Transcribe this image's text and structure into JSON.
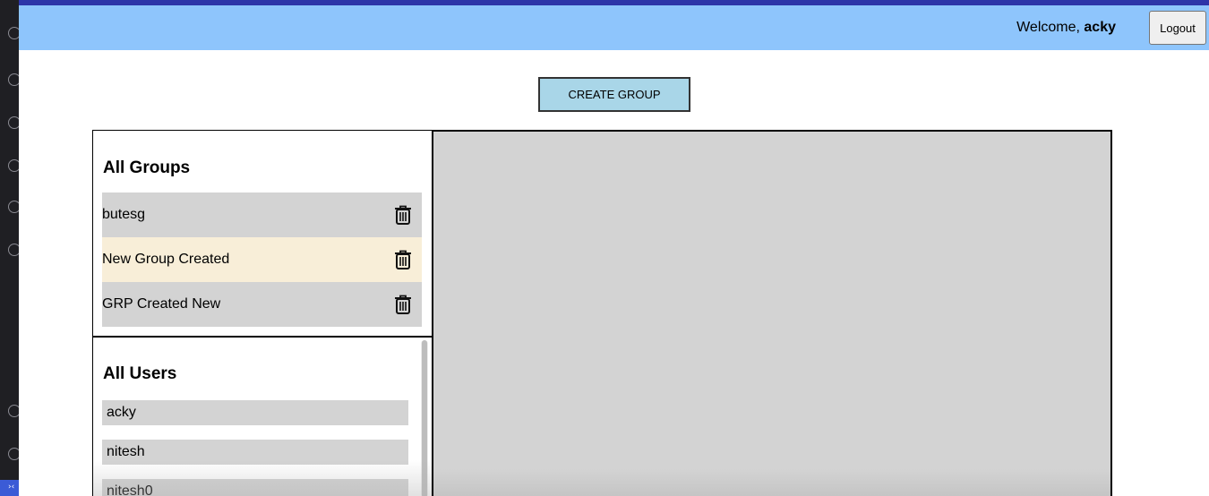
{
  "header": {
    "welcome_prefix": "Welcome,",
    "username": "acky",
    "logout_label": "Logout",
    "background": "#8ec5fc"
  },
  "actions": {
    "create_group_label": "CREATE GROUP"
  },
  "groups": {
    "title": "All Groups",
    "items": [
      {
        "name": "butesg",
        "icon": "trash-icon",
        "selected": false
      },
      {
        "name": "New Group Created",
        "icon": "trash-icon",
        "selected": true
      },
      {
        "name": "GRP Created New",
        "icon": "trash-icon",
        "selected": false
      }
    ]
  },
  "users": {
    "title": "All Users",
    "items": [
      "acky",
      "nitesh",
      "nitesh0"
    ]
  },
  "colors": {
    "item_bg": "#d3d3d3",
    "selected_bg": "#f8eed8",
    "create_button_bg": "#a9d6e8",
    "top_band": "#2d35a8"
  }
}
